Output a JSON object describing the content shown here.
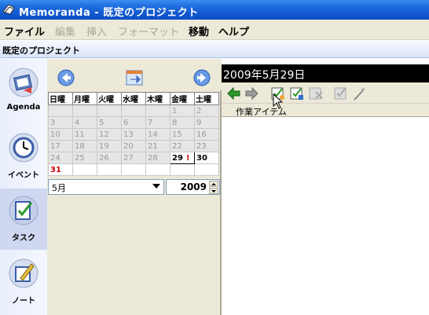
{
  "window": {
    "title": "Memoranda - 既定のプロジェクト"
  },
  "menu": {
    "items": [
      {
        "label": "ファイル",
        "enabled": true
      },
      {
        "label": "編集",
        "enabled": false
      },
      {
        "label": "挿入",
        "enabled": false
      },
      {
        "label": "フォーマット",
        "enabled": false
      },
      {
        "label": "移動",
        "enabled": true
      },
      {
        "label": "ヘルプ",
        "enabled": true
      }
    ]
  },
  "project": {
    "name": "既定のプロジェクト"
  },
  "nav": {
    "items": [
      {
        "label": "Agenda",
        "icon": "agenda-icon"
      },
      {
        "label": "イベント",
        "icon": "clock-icon"
      },
      {
        "label": "タスク",
        "icon": "task-icon",
        "active": true
      },
      {
        "label": "ノート",
        "icon": "note-icon"
      }
    ]
  },
  "calendar": {
    "weekdays": [
      "日曜",
      "月曜",
      "火曜",
      "水曜",
      "木曜",
      "金曜",
      "土曜"
    ],
    "weeks": [
      [
        "",
        "",
        "",
        "",
        "",
        "1",
        "2"
      ],
      [
        "3",
        "4",
        "5",
        "6",
        "7",
        "8",
        "9"
      ],
      [
        "10",
        "11",
        "12",
        "13",
        "14",
        "15",
        "16"
      ],
      [
        "17",
        "18",
        "19",
        "20",
        "21",
        "22",
        "23"
      ],
      [
        "24",
        "25",
        "26",
        "27",
        "28",
        "29",
        "30"
      ],
      [
        "31",
        "",
        "",
        "",
        "",
        "",
        ""
      ]
    ],
    "selected_day": "29",
    "selected_mark": "!",
    "month": "5月",
    "year": "2009"
  },
  "main": {
    "date_title": "2009年5月29日",
    "column_header": "作業アイテム"
  },
  "colors": {
    "titlebar": "#1257cf",
    "menubar": "#ece9d8",
    "date_header_bg": "#000000"
  }
}
